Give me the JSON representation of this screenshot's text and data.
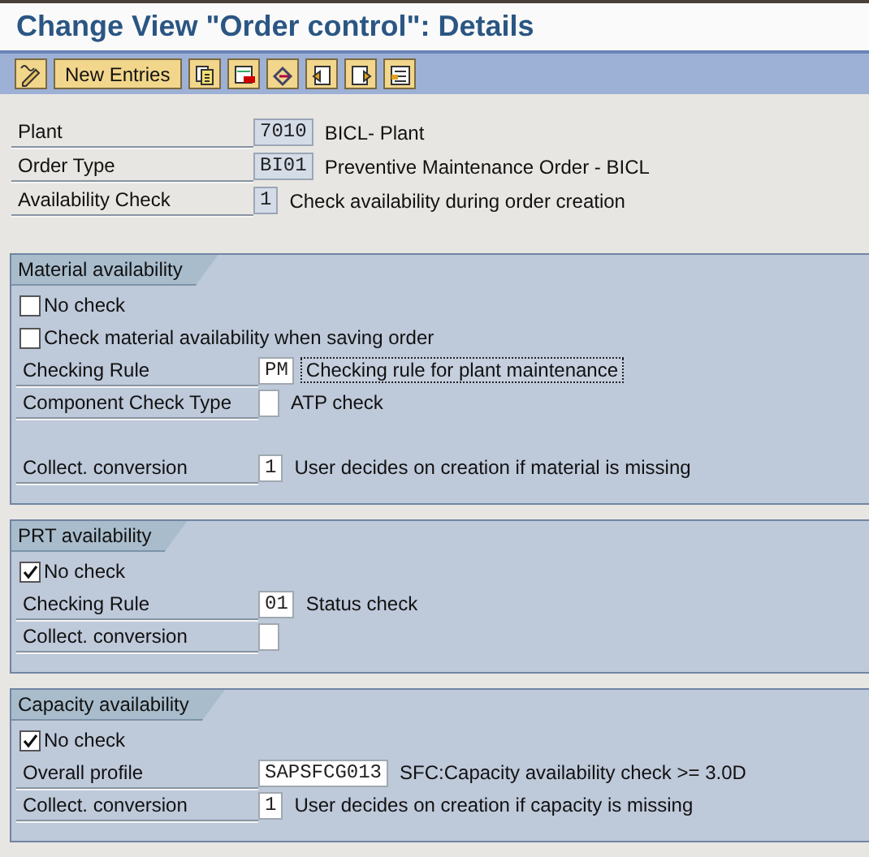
{
  "window": {
    "title": "Change View \"Order control\": Details"
  },
  "toolbar": [
    {
      "kind": "icon"
    },
    {
      "kind": "text",
      "label": "New Entries"
    },
    {
      "kind": "icon"
    },
    {
      "kind": "icon"
    },
    {
      "kind": "icon"
    },
    {
      "kind": "icon"
    },
    {
      "kind": "icon"
    },
    {
      "kind": "icon"
    }
  ],
  "header_fields": [
    {
      "label": "Plant",
      "value": "7010",
      "readonly": true,
      "description": "BICL- Plant"
    },
    {
      "label": "Order Type",
      "value": "BI01",
      "readonly": true,
      "description": "Preventive Maintenance Order - BICL"
    },
    {
      "label": "Availability Check",
      "value": "1",
      "readonly": true,
      "description": "Check availability during order creation"
    }
  ],
  "groups": [
    {
      "title": "Material availability",
      "rows": [
        {
          "kind": "checkbox",
          "label": "No check",
          "checked": false
        },
        {
          "kind": "checkbox",
          "label": "Check material availability when saving order",
          "checked": false
        },
        {
          "kind": "field",
          "label": "Checking Rule",
          "value": "PM",
          "readonly": false,
          "description": "Checking rule for plant maintenance",
          "focused": true
        },
        {
          "kind": "field",
          "label": "Component Check Type",
          "readonly": false,
          "description": "ATP check",
          "focused": false
        },
        {
          "kind": "spacer"
        },
        {
          "kind": "field",
          "label": "Collect. conversion",
          "value": "1",
          "readonly": false,
          "description": "User decides on creation if material is missing",
          "focused": false
        }
      ]
    },
    {
      "title": "PRT availability",
      "rows": [
        {
          "kind": "checkbox",
          "label": "No check",
          "checked": true
        },
        {
          "kind": "field",
          "label": "Checking Rule",
          "value": "01",
          "readonly": false,
          "description": "Status check",
          "focused": false
        },
        {
          "kind": "field",
          "label": "Collect. conversion",
          "readonly": false
        }
      ]
    },
    {
      "title": "Capacity availability",
      "rows": [
        {
          "kind": "checkbox",
          "label": "No check",
          "checked": true
        },
        {
          "kind": "field",
          "label": "Overall profile",
          "value": "SAPSFCG013",
          "readonly": false,
          "description": "SFC:Capacity availability check >= 3.0D",
          "focused": false
        },
        {
          "kind": "field",
          "label": "Collect. conversion",
          "value": "1",
          "readonly": false,
          "description": "User decides on creation if capacity is missing",
          "focused": false
        }
      ]
    }
  ]
}
